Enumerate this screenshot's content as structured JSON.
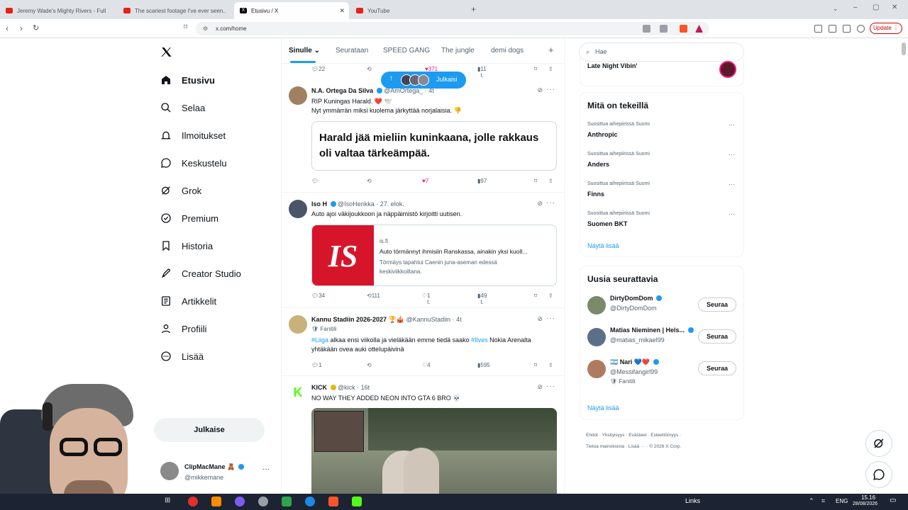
{
  "browser": {
    "tabs": [
      {
        "title": "Jeremy Wade's Mighty Rivers - Full E",
        "color": "#e62117"
      },
      {
        "title": "The scariest footage I've ever seen...",
        "color": "#e62117"
      },
      {
        "title": "Etusivu / X",
        "color": "#000000",
        "active": true
      },
      {
        "title": "YouTube",
        "color": "#e62117"
      }
    ],
    "url": "x.com/home",
    "update_label": "Update"
  },
  "nav": {
    "items": [
      {
        "label": "Etusivu",
        "icon": "home-icon",
        "active": true
      },
      {
        "label": "Selaa",
        "icon": "search-icon"
      },
      {
        "label": "Ilmoitukset",
        "icon": "bell-icon"
      },
      {
        "label": "Keskustelu",
        "icon": "chat-icon"
      },
      {
        "label": "Grok",
        "icon": "grok-icon"
      },
      {
        "label": "Premium",
        "icon": "verified-icon"
      },
      {
        "label": "Historia",
        "icon": "bookmark-icon"
      },
      {
        "label": "Creator Studio",
        "icon": "rocket-icon"
      },
      {
        "label": "Artikkelit",
        "icon": "article-icon"
      },
      {
        "label": "Profiili",
        "icon": "person-icon"
      },
      {
        "label": "Lisää",
        "icon": "more-circle-icon"
      }
    ],
    "post_label": "Julkaise",
    "account": {
      "name": "ClipMacMane 🧸",
      "handle": "@mikkemane"
    }
  },
  "main": {
    "tabs": [
      "Sinulle",
      "Seurataan",
      "SPEED GANG",
      "The jungle",
      "demi dogs"
    ],
    "new_posts_label": "Julkaisi",
    "top_actions": {
      "replies": "22",
      "likes": "371",
      "views": "11 t."
    },
    "tweets": [
      {
        "name": "N.A. Ortega Da Silva",
        "handle": "@AmOrtega_",
        "time": "4t",
        "lines": [
          "RIP Kuningas Harald. ❤️ 🕊️",
          "Nyt ymmärrän miksi kuolema järkyttää norjalaisia. 👎"
        ],
        "quote": "Harald jää mieliin kuninkaana, jolle rakkaus oli valtaa tärkeämpää.",
        "replies": "",
        "retweets": "",
        "likes": "7",
        "views": "97"
      },
      {
        "name": "Iso H",
        "handle": "@IsoHenkka",
        "time": "27. elok.",
        "lines": [
          "Auto ajoi väkijoukkoon ja näppäimistö kirjoitti uutisen."
        ],
        "link": {
          "domain": "is.fi",
          "title": "Auto törmännyt ihmisiin Ranskassa, ainakin yksi kuoll...",
          "desc1": "Törmäys tapahtui Caenin juna-aseman edessä",
          "desc2": "keskiviikkoiltana.",
          "logo": "IS"
        },
        "replies": "34",
        "retweets": "111",
        "likes": "1 t.",
        "views": "49 t."
      },
      {
        "name": "Kannu Stadiin 2026-2027 🏆🎪",
        "handle": "@KannuStadiin",
        "time": "4t",
        "badge": "Fanitili",
        "line1_parts": [
          "#Liiga",
          " alkaa ensi viikolla ja vieläkään emme tiedä saako ",
          "#Ilves",
          " Nokia Arenalta"
        ],
        "line2": "yhtäkään ovea auki ottelupäivinä",
        "replies": "1",
        "retweets": "",
        "likes": "4",
        "views": "595"
      },
      {
        "name": "KICK",
        "handle": "@kick",
        "time": "16t",
        "lines": [
          "NO WAY THEY ADDED NEON INTO GTA 6 BRO 💀"
        ]
      }
    ]
  },
  "right": {
    "search_placeholder": "Hae",
    "top_label": "Late Night Vibin'",
    "trends_title": "Mitä on tekeillä",
    "trends": [
      {
        "context": "Suosittua aihepiirissä Suomi",
        "name": "Anthropic"
      },
      {
        "context": "Suosittua aihepiirissä Suomi",
        "name": "Anders"
      },
      {
        "context": "Suosittua aihepiirissä Suomi",
        "name": "Finns"
      },
      {
        "context": "Suosittua aihepiirissä Suomi",
        "name": "Suomen BKT"
      }
    ],
    "show_more": "Näytä lisää",
    "follow_title": "Uusia seurattavia",
    "follows": [
      {
        "name": "DirtyDomDom",
        "handle": "@DirtyDomDom",
        "button": "Seuraa",
        "color": "#7a8a6a"
      },
      {
        "name": "Matias Nieminen | Hels...",
        "handle": "@matias_mikael99",
        "button": "Seuraa",
        "color": "#5b6f8a"
      },
      {
        "name": "🇦🇷 Nari 💙❤️",
        "handle": "@Messifangirl99",
        "badge": "Fanitili",
        "button": "Seuraa",
        "color": "#b07a60"
      }
    ],
    "footer_line1": "Ehdot · Yksityisyys · Evästeet · Esteettömyys ·",
    "footer_line2": "Tietoa mainoksista · Lisää ··· · © 2026 X Corp."
  },
  "taskbar": {
    "links_label": "Links",
    "lang": "ENG",
    "time": "15.16",
    "date": "28/08/2026"
  }
}
